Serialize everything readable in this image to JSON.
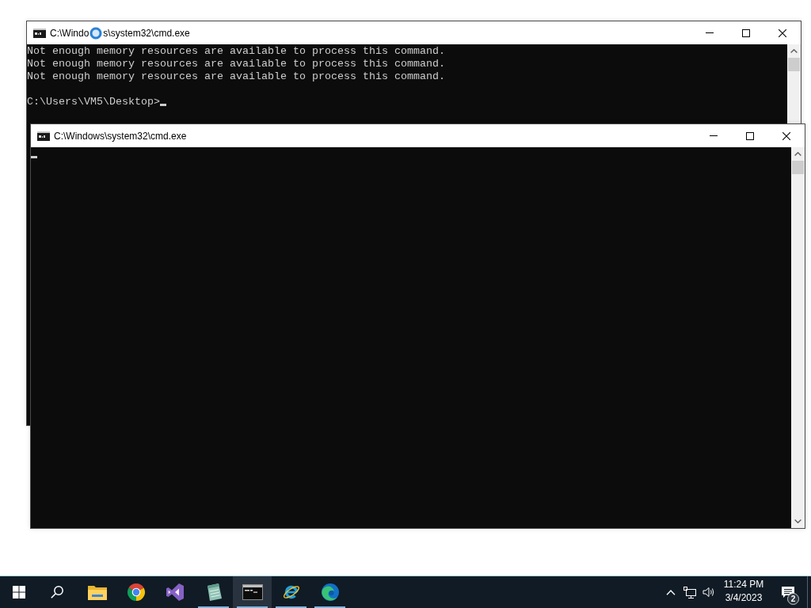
{
  "windows": [
    {
      "title": "C:\\Windo",
      "title_after_pointer": "s\\system32\\cmd.exe",
      "console": {
        "lines": [
          "Not enough memory resources are available to process this command.",
          "Not enough memory resources are available to process this command.",
          "Not enough memory resources are available to process this command."
        ],
        "prompt": "C:\\Users\\VM5\\Desktop>"
      }
    },
    {
      "title": "C:\\Windows\\system32\\cmd.exe"
    }
  ],
  "taskbar": {
    "apps": [
      {
        "running": false,
        "active": false
      },
      {
        "running": false,
        "active": false
      },
      {
        "running": false,
        "active": false
      },
      {
        "running": true,
        "active": false
      },
      {
        "running": true,
        "active": true
      },
      {
        "running": true,
        "active": false
      },
      {
        "running": true,
        "active": false
      }
    ],
    "tray": {
      "time": "11:24 PM",
      "date": "3/4/2023",
      "notification_count": "2"
    }
  }
}
